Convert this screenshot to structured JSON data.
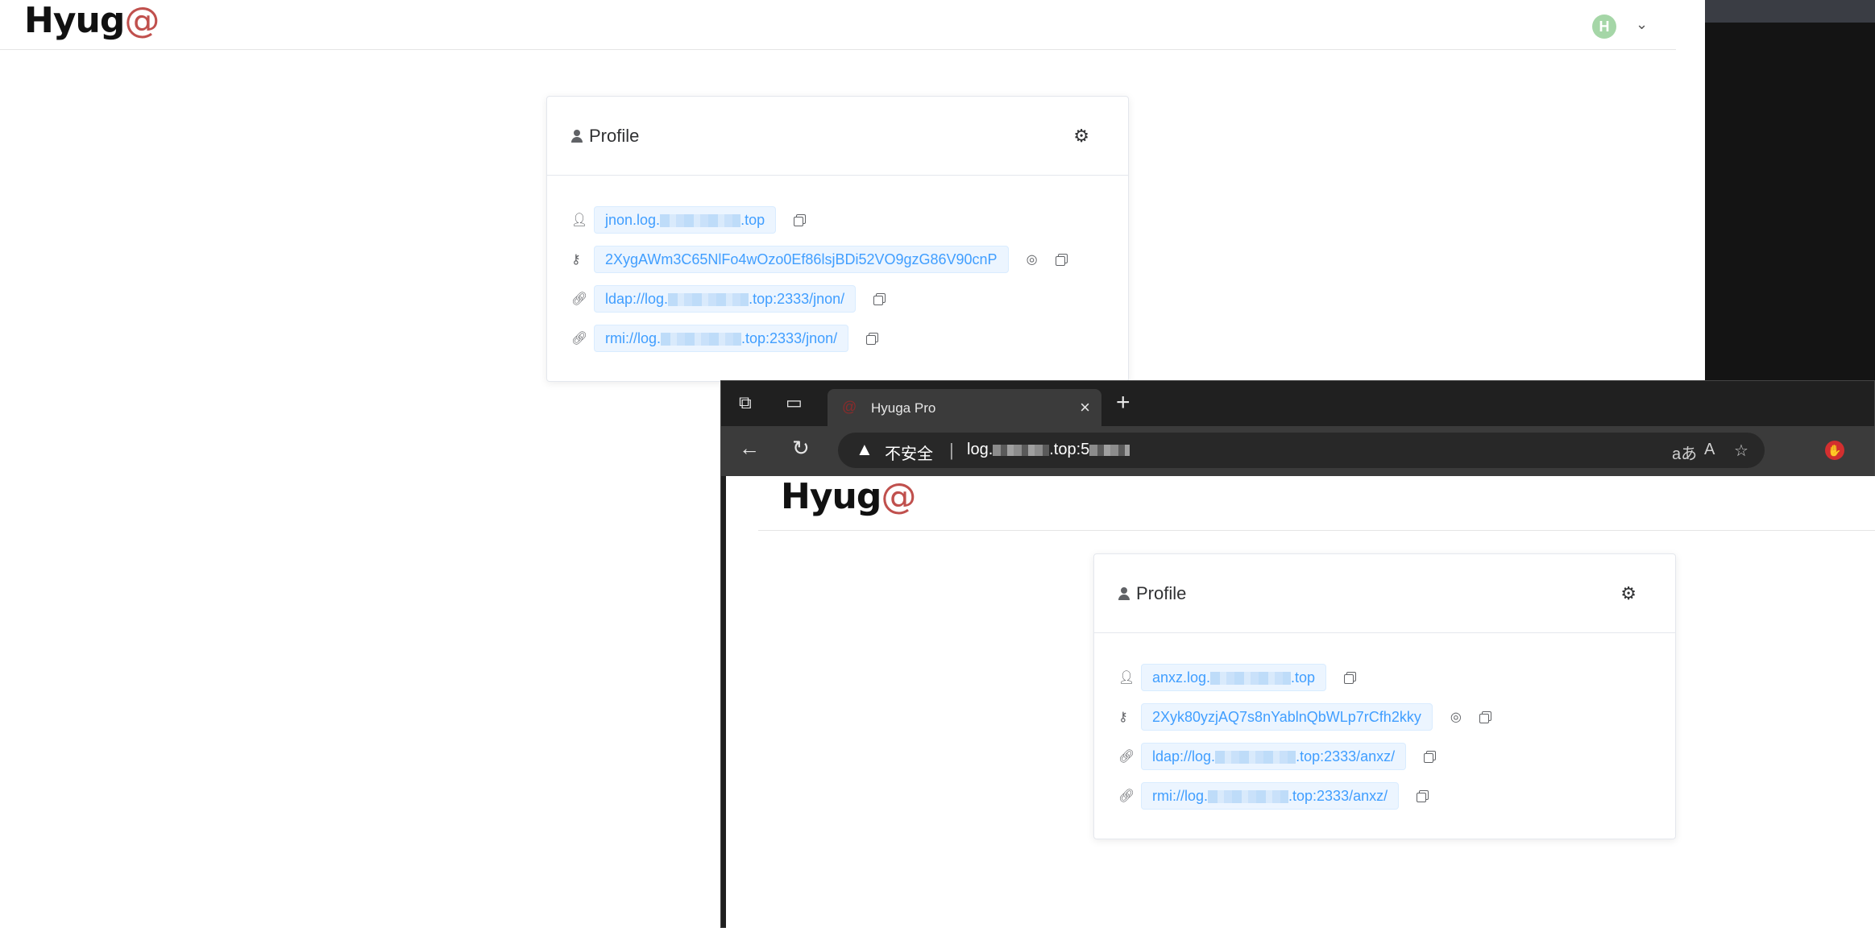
{
  "back_page": {
    "logo_text": "Hyug",
    "logo_swirl": "@",
    "avatar_letter": "H",
    "card": {
      "title": "Profile",
      "dns": {
        "prefix": "jnon.log.",
        "suffix": ".top"
      },
      "token": "2XygAWm3C65NlFo4wOzo0Ef86lsjBDi52VO9gzG86V90cnP",
      "ldap": {
        "prefix": "ldap://log.",
        "suffix": ".top:2333/jnon/"
      },
      "rmi": {
        "prefix": "rmi://log.",
        "suffix": ".top:2333/jnon/"
      }
    }
  },
  "browser": {
    "tab_title": "Hyuga Pro",
    "security_label": "不安全",
    "url_prefix": "log.",
    "url_suffix": ".top:5",
    "separator": "|"
  },
  "front_page": {
    "logo_text": "Hyug",
    "logo_swirl": "@",
    "card": {
      "title": "Profile",
      "dns": {
        "prefix": "anxz.log.",
        "suffix": ".top"
      },
      "token": "2Xyk80yzjAQ7s8nYablnQbWLp7rCfh2kky",
      "ldap": {
        "prefix": "ldap://log.",
        "suffix": ".top:2333/anxz/"
      },
      "rmi": {
        "prefix": "rmi://log.",
        "suffix": ".top:2333/anxz/"
      }
    }
  },
  "icons": {
    "user": "user-icon",
    "key": "key-icon",
    "link": "link-icon",
    "copy": "copy-icon",
    "eye_off": "eye-off-icon",
    "gear": "gear-icon"
  },
  "colors": {
    "tag_bg": "#ecf5ff",
    "tag_text": "#409eff",
    "browser_dark": "#202020"
  }
}
